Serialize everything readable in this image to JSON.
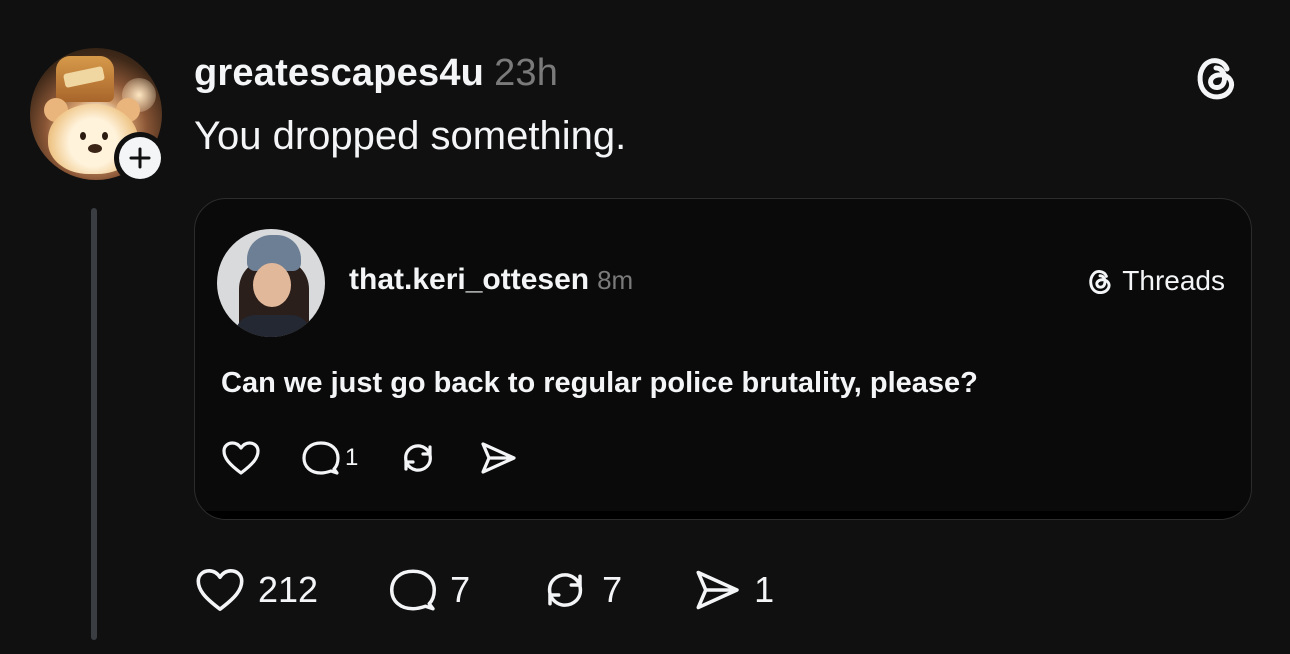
{
  "post": {
    "username": "greatescapes4u",
    "timestamp": "23h",
    "text": "You dropped something.",
    "likes": "212",
    "replies": "7",
    "reposts": "7",
    "shares": "1"
  },
  "quoted_post": {
    "username": "that.keri_ottesen",
    "timestamp": "8m",
    "brand_label": "Threads",
    "text": "Can we just go back to regular police brutality, please?",
    "replies": "1"
  },
  "icons": {
    "app_logo": "threads-logo-icon",
    "follow": "plus-icon",
    "like": "heart-icon",
    "reply": "comment-icon",
    "repost": "repost-icon",
    "share": "send-icon"
  },
  "colors": {
    "background": "#101010",
    "text": "#f3f5f7",
    "secondary_text": "#7a7a7a",
    "thread_line": "#3a3d42"
  }
}
